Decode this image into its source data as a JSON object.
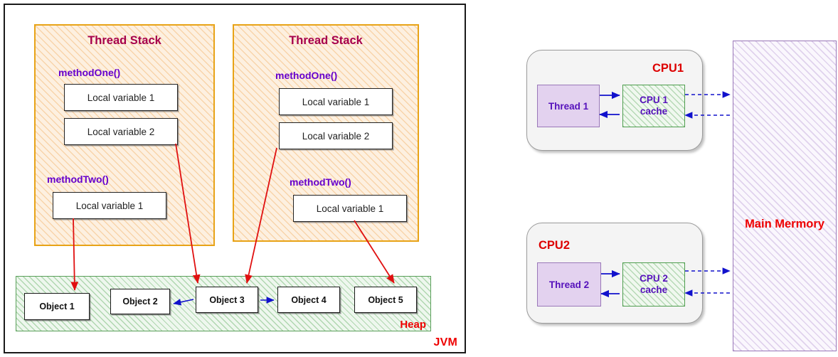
{
  "jvm": {
    "label": "JVM",
    "label_color": "#ee0000",
    "border_color": "#1a1a1a",
    "thread_stacks": [
      {
        "title": "Thread Stack",
        "title_color": "#a6004c",
        "border_color": "#e8a317",
        "methods": [
          {
            "name": "methodOne()",
            "name_color": "#6600cc",
            "variables": [
              "Local variable 1",
              "Local variable 2"
            ]
          },
          {
            "name": "methodTwo()",
            "name_color": "#6600cc",
            "variables": [
              "Local variable 1"
            ]
          }
        ]
      },
      {
        "title": "Thread Stack",
        "title_color": "#a6004c",
        "border_color": "#e8a317",
        "methods": [
          {
            "name": "methodOne()",
            "name_color": "#6600cc",
            "variables": [
              "Local variable 1",
              "Local variable 2"
            ]
          },
          {
            "name": "methodTwo()",
            "name_color": "#6600cc",
            "variables": [
              "Local variable 1"
            ]
          }
        ]
      }
    ],
    "heap": {
      "label": "Heap",
      "label_color": "#ee0000",
      "border_color": "#5aa05a",
      "objects": [
        "Object 1",
        "Object 2",
        "Object 3",
        "Object 4",
        "Object 5"
      ]
    }
  },
  "memory_model": {
    "cpus": [
      {
        "label": "CPU1",
        "label_color": "#dd0000",
        "thread": "Thread 1",
        "cache_line1": "CPU 1",
        "cache_line2": "cache"
      },
      {
        "label": "CPU2",
        "label_color": "#dd0000",
        "thread": "Thread 2",
        "cache_line1": "CPU 2",
        "cache_line2": "cache"
      }
    ],
    "main_memory": {
      "label": "Main Mermory",
      "label_color": "#ee0000",
      "border_color": "#9a78b8"
    }
  },
  "colors": {
    "red_arrow": "#e01010",
    "blue_arrow": "#1111cc",
    "purple_text": "#5511bb",
    "stack_fill": "#fdf0e0",
    "heap_fill": "#eef7ee"
  }
}
